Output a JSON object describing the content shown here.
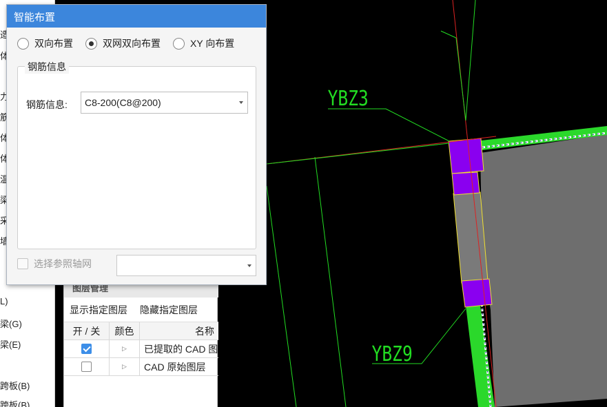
{
  "dialog": {
    "title": "智能布置",
    "layout_options": [
      {
        "label": "双向布置",
        "selected": false
      },
      {
        "label": "双网双向布置",
        "selected": true
      },
      {
        "label": "XY 向布置",
        "selected": false
      }
    ],
    "rebar_group_title": "钢筋信息",
    "rebar_field_label": "钢筋信息:",
    "rebar_field_value": "C8-200(C8@200)",
    "ref_axis_label": "选择参照轴网",
    "ref_axis_checked": false,
    "ref_axis_value": ""
  },
  "left_strip": {
    "visible_chars": [
      "造",
      "体",
      "力",
      "筋",
      "体",
      "体",
      "温",
      "梁",
      "采",
      "墙",
      "L)",
      "梁(G)",
      "梁(E)",
      "跨板(B)",
      "跨板(B)"
    ]
  },
  "layer_panel": {
    "title": "图层管理",
    "show_button": "显示指定图层",
    "hide_button": "隐藏指定图层",
    "columns": [
      "开 / 关",
      "颜色",
      "名称"
    ],
    "rows": [
      {
        "checked": true,
        "name": "已提取的 CAD 图"
      },
      {
        "checked": false,
        "name": "CAD 原始图层"
      }
    ]
  },
  "cad_view": {
    "labels": [
      "YBZ3",
      "YBZ9"
    ],
    "colors": {
      "background": "#000000",
      "line": "#22dd22",
      "wall_fill": "#2bd82b",
      "slab_fill": "#6e6e6e",
      "column_fill": "#8a00f0",
      "axis": "#dd2222",
      "outline": "#f0e030"
    }
  },
  "colors": {
    "titlebar": "#3c86dc",
    "check_on": "#3c8ee8"
  }
}
